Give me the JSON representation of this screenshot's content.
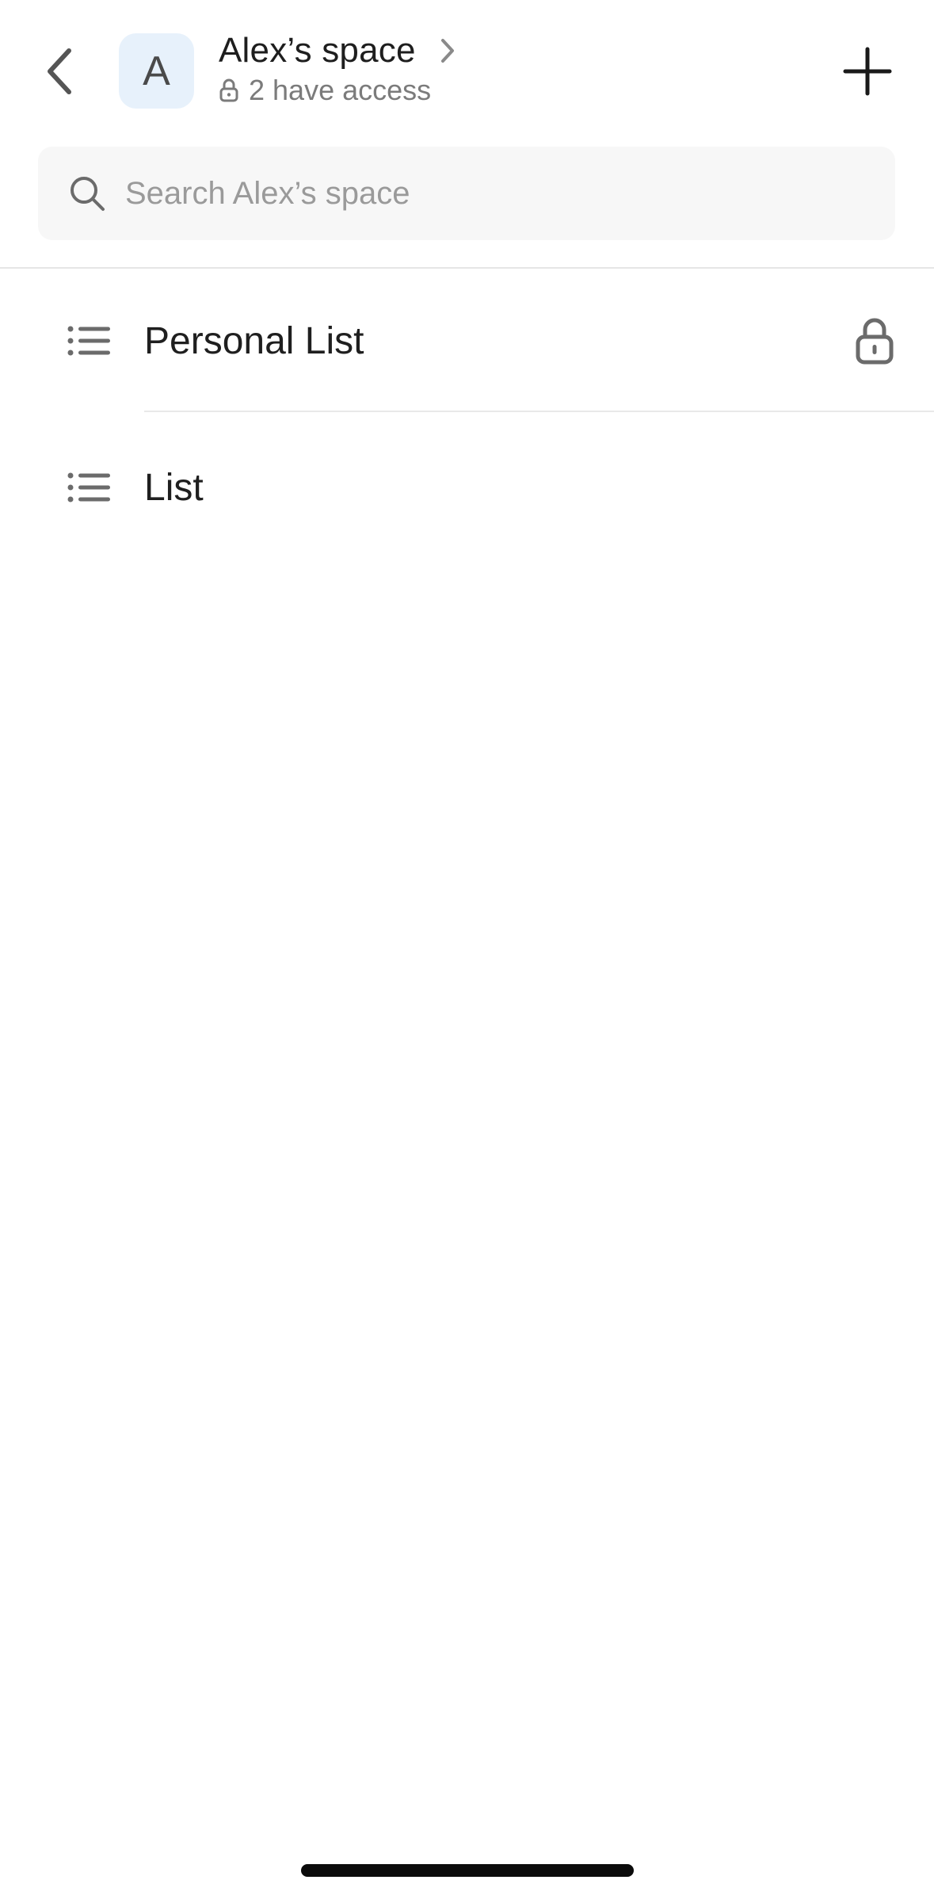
{
  "header": {
    "avatar_letter": "A",
    "space_title": "Alex’s space",
    "access_text": "2 have access"
  },
  "search": {
    "placeholder": "Search Alex’s space",
    "value": ""
  },
  "lists": [
    {
      "label": "Personal List",
      "icon": "list-icon",
      "locked": true
    },
    {
      "label": "List",
      "icon": "list-icon",
      "locked": false
    }
  ],
  "colors": {
    "avatar_bg": "#e7f1fb",
    "search_bg": "#f7f7f7",
    "primary_text": "#1f1f1f",
    "secondary_text": "#7b7b7b",
    "icon_gray": "#6b6b6b"
  }
}
